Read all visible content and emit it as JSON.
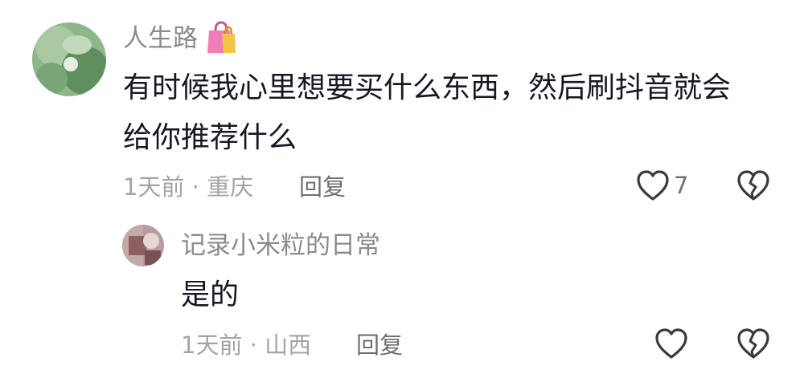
{
  "comments": [
    {
      "username": "人生路",
      "badge_icon": "shopping-bag-icon",
      "text_lines": [
        "有时候我心里想要买什么东西，然后刷抖音就会",
        "给你推荐什么"
      ],
      "meta": "1天前 · 重庆",
      "reply_label": "回复",
      "like_count": "7",
      "like_icon": "heart-outline-icon",
      "dislike_icon": "broken-heart-icon"
    },
    {
      "username": "记录小米粒的日常",
      "text_lines": [
        "是的"
      ],
      "meta": "1天前 · 山西",
      "reply_label": "回复",
      "like_icon": "heart-outline-icon",
      "dislike_icon": "broken-heart-icon"
    }
  ],
  "colors": {
    "username": "#8a8b91",
    "text": "#161823",
    "meta": "#a3a4a8",
    "reply": "#6e6f75",
    "icon": "#3a3a3e"
  }
}
